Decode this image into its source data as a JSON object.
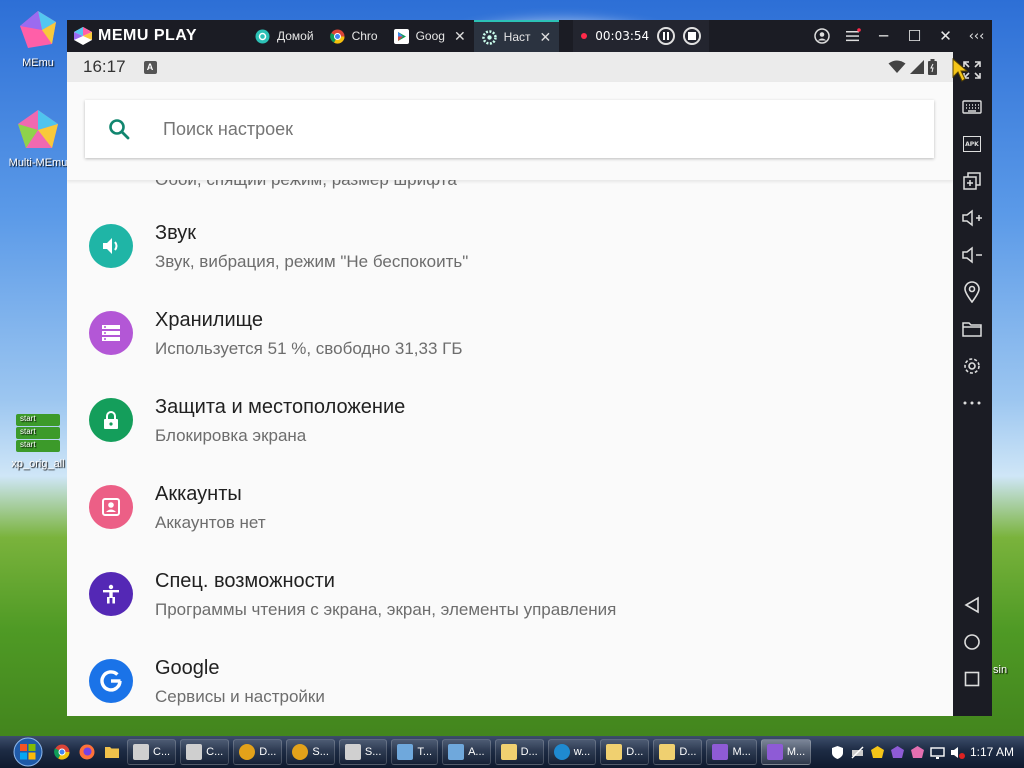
{
  "desktop": {
    "icons": [
      {
        "label": "MEmu"
      },
      {
        "label": "Multi-MEmu"
      },
      {
        "label": "xp_orig_all"
      }
    ],
    "shortcut_texts": [
      "start",
      "start",
      "start"
    ],
    "partial_label": "sin"
  },
  "memu": {
    "logo_text": "MEMU PLAY",
    "tabs": [
      {
        "label": "Домой",
        "color": "#2cc1b6"
      },
      {
        "label": "Chro",
        "color": "#ffffff"
      },
      {
        "label": "Goog",
        "color": "#ffffff"
      },
      {
        "label": "Наст",
        "color": "#2cc1b6"
      }
    ],
    "record_time": "00:03:54",
    "window_controls": [
      "user-icon",
      "menu-icon",
      "minimize-icon",
      "maximize-icon",
      "close-icon",
      "collapse-icon"
    ]
  },
  "android": {
    "status": {
      "time": "16:17",
      "badge": "A"
    },
    "search": {
      "placeholder": "Поиск настроек"
    },
    "partial_item": {
      "subtitle": "Обои, спящий режим, размер шрифта"
    },
    "items": [
      {
        "title": "Звук",
        "subtitle": "Звук, вибрация, режим \"Не беспокоить\"",
        "color": "#1fb5a6",
        "icon": "volume-icon"
      },
      {
        "title": "Хранилище",
        "subtitle": "Используется 51 %, свободно 31,33 ГБ",
        "color": "#b357d6",
        "icon": "storage-icon"
      },
      {
        "title": "Защита и местоположение",
        "subtitle": "Блокировка экрана",
        "color": "#149e5b",
        "icon": "lock-icon"
      },
      {
        "title": "Аккаунты",
        "subtitle": "Аккаунтов нет",
        "color": "#ec5f86",
        "icon": "account-icon"
      },
      {
        "title": "Спец. возможности",
        "subtitle": "Программы чтения с экрана, экран, элементы управления",
        "color": "#5428b5",
        "icon": "accessibility-icon"
      },
      {
        "title": "Google",
        "subtitle": "Сервисы и настройки",
        "color": "#ffffff",
        "icon": "google-icon"
      }
    ]
  },
  "sidebar": [
    "fullscreen-icon",
    "keyboard-icon",
    "apk-icon",
    "multi-window-icon",
    "volume-up-icon",
    "volume-down-icon",
    "location-icon",
    "folder-icon",
    "settings-icon",
    "more-icon",
    "back-icon",
    "home-icon",
    "recents-icon"
  ],
  "sidebar_apk_text": "APK",
  "taskbar": {
    "buttons": [
      {
        "label": "C...",
        "color": "#cfcfcf"
      },
      {
        "label": "C...",
        "color": "#cfcfcf"
      },
      {
        "label": "D...",
        "color": "#e3a21a"
      },
      {
        "label": "S...",
        "color": "#e3a21a"
      },
      {
        "label": "S...",
        "color": "#d0d0d0"
      },
      {
        "label": "T...",
        "color": "#6fa8dc"
      },
      {
        "label": "A...",
        "color": "#6fa8dc"
      },
      {
        "label": "D...",
        "color": "#f0d070"
      },
      {
        "label": "w...",
        "color": "#1f8ad1"
      },
      {
        "label": "D...",
        "color": "#f0d070"
      },
      {
        "label": "D...",
        "color": "#f0d070"
      },
      {
        "label": "M...",
        "color": "#8e5bd6"
      },
      {
        "label": "M...",
        "color": "#8e5bd6"
      }
    ],
    "clock": "1:17 AM"
  }
}
